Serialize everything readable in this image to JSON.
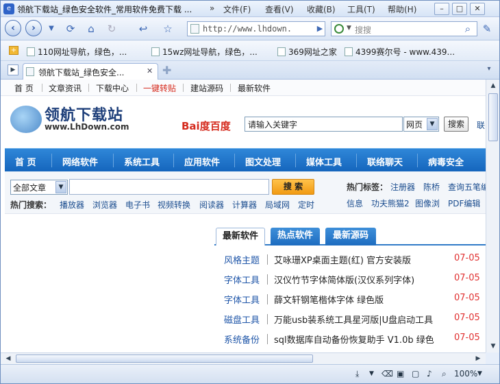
{
  "window": {
    "title": "领航下载站_绿色安全软件_常用软件免费下载 ...",
    "overflow": "»",
    "menu": [
      "文件(F)",
      "查看(V)",
      "收藏(B)",
      "工具(T)",
      "帮助(H)"
    ],
    "controls": [
      "–",
      "□",
      "✕"
    ]
  },
  "nav": {
    "address": "http://www.lhdown.",
    "search_placeholder": "搜搜",
    "icons": [
      "back-icon",
      "forward-icon",
      "history-dropdown-icon",
      "refresh-icon",
      "home-icon",
      "reload-icon",
      "undo-icon",
      "favorite-star-icon",
      "go-icon",
      "search-icon",
      "edit-icon"
    ]
  },
  "bookmarks": [
    "110网址导航，绿色，...",
    "15wz网址导航，绿色，...",
    "369网址之家",
    "4399赛尔号 - www.439..."
  ],
  "tabs": [
    {
      "label": "领航下载站_绿色安全..."
    }
  ],
  "page": {
    "topnav": [
      "首 页",
      "文章资讯",
      "下载中心",
      "一键转贴",
      "建站源码",
      "最新软件"
    ],
    "logo_title": "领航下载站",
    "logo_sub": "www.LhDown.com",
    "baidu_label": "Bai度百度",
    "keyword_input": "请输入关键字",
    "search_scope": "网页",
    "search_button": "搜索",
    "search_cut": "联",
    "mainnav": [
      "首 页",
      "网络软件",
      "系统工具",
      "应用软件",
      "图文处理",
      "媒体工具",
      "联络聊天",
      "病毒安全"
    ],
    "article_select": "全部文章",
    "search_submit": "搜 索",
    "hot_search_label": "热门搜索：",
    "hot_searches": [
      "播放器",
      "浏览器",
      "电子书",
      "视频转换",
      "阅读器",
      "计算器",
      "局域网",
      "定时"
    ],
    "hot_tags_label": "热门标签：",
    "hot_tags_row1": [
      "注册器",
      "陈桥",
      "查询五笔编"
    ],
    "hot_tags_row2": [
      "信息",
      "功夫熊猫2",
      "图像浏",
      "PDF编辑"
    ],
    "panel_tabs": [
      "最新软件",
      "热点软件",
      "最新源码"
    ],
    "list": [
      {
        "cat": "风格主题",
        "name": "艾咏珊XP桌面主题(红) 官方安装版",
        "date": "07-05"
      },
      {
        "cat": "字体工具",
        "name": "汉仪竹节字体简体版(汉仪系列字体)",
        "date": "07-05"
      },
      {
        "cat": "字体工具",
        "name": "薛文轩钢笔楷体字体 绿色版",
        "date": "07-05"
      },
      {
        "cat": "磁盘工具",
        "name": "万能usb装系统工具星河版|U盘启动工具",
        "date": "07-05"
      },
      {
        "cat": "系统备份",
        "name": "sql数据库自动备份恢复助手 V1.0b 绿色",
        "date": "07-05"
      }
    ]
  },
  "status": {
    "zoom": "100%"
  },
  "colors": {
    "accent_blue": "#1566bd",
    "date_red": "#e03030",
    "search_orange": "#f19a12",
    "highlight_red": "#d52b1e"
  }
}
